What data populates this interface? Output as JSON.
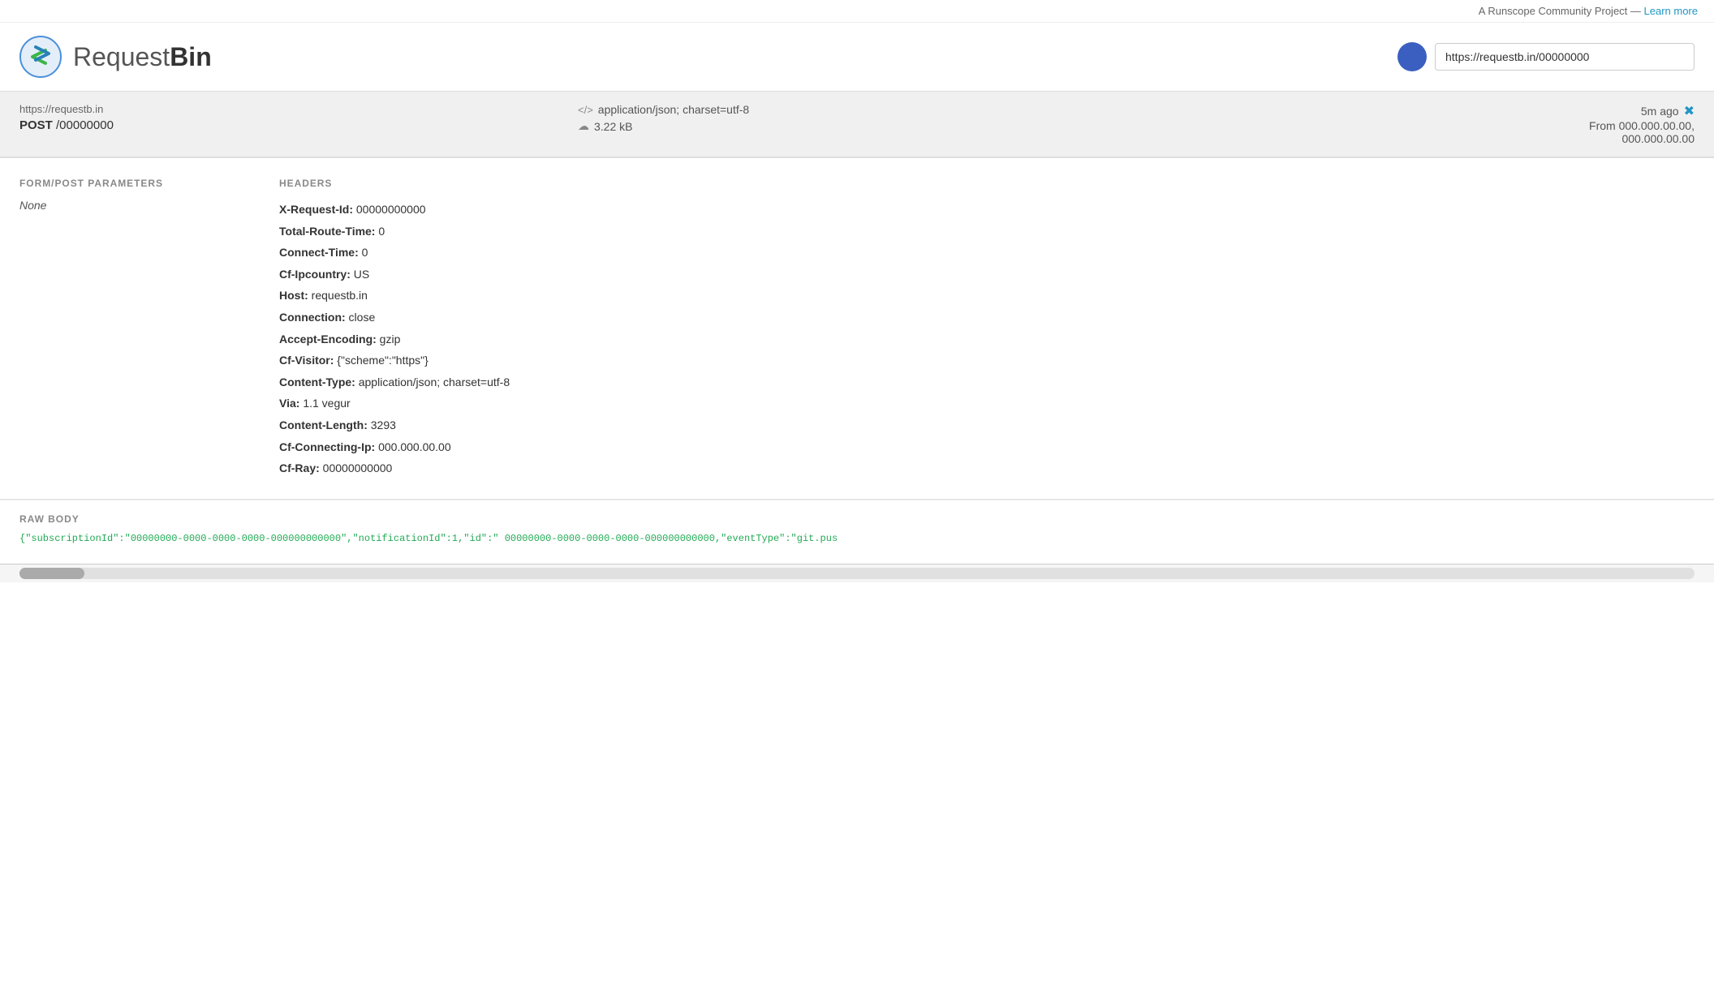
{
  "topBanner": {
    "text": "A Runscope Community Project — ",
    "linkText": "Learn more",
    "linkHref": "#"
  },
  "header": {
    "logoText": "Request",
    "logoTextBold": "Bin",
    "urlInput": "https://requestb.in/00000000",
    "urlInputPlaceholder": "https://requestb.in/00000000"
  },
  "requestBar": {
    "urlSmall": "https://requestb.in",
    "method": "POST",
    "path": "/00000000",
    "contentType": "</> application/json; charset=utf-8",
    "size": "3.22 kB",
    "timeAgo": "5m ago",
    "from": "From 000.000.00.00,",
    "fromLine2": "000.000.00.00"
  },
  "formPost": {
    "sectionTitle": "FORM/POST PARAMETERS",
    "value": "None"
  },
  "headers": {
    "sectionTitle": "HEADERS",
    "items": [
      {
        "key": "X-Request-Id:",
        "value": "00000000000"
      },
      {
        "key": "Total-Route-Time:",
        "value": "0"
      },
      {
        "key": "Connect-Time:",
        "value": "0"
      },
      {
        "key": "Cf-Ipcountry:",
        "value": "US"
      },
      {
        "key": "Host:",
        "value": "requestb.in"
      },
      {
        "key": "Connection:",
        "value": "close"
      },
      {
        "key": "Accept-Encoding:",
        "value": "gzip"
      },
      {
        "key": "Cf-Visitor:",
        "value": "{\"scheme\":\"https\"}"
      },
      {
        "key": "Content-Type:",
        "value": "application/json; charset=utf-8"
      },
      {
        "key": "Via:",
        "value": "1.1 vegur"
      },
      {
        "key": "Content-Length:",
        "value": "3293"
      },
      {
        "key": "Cf-Connecting-Ip:",
        "value": "000.000.00.00"
      },
      {
        "key": "Cf-Ray:",
        "value": "00000000000"
      }
    ]
  },
  "rawBody": {
    "sectionTitle": "RAW BODY",
    "content": "{\"subscriptionId\":\"00000000-0000-0000-0000-000000000000\",\"notificationId\":1,\"id\":\" 00000000-0000-0000-0000-000000000000,\"eventType\":\"git.pus"
  }
}
